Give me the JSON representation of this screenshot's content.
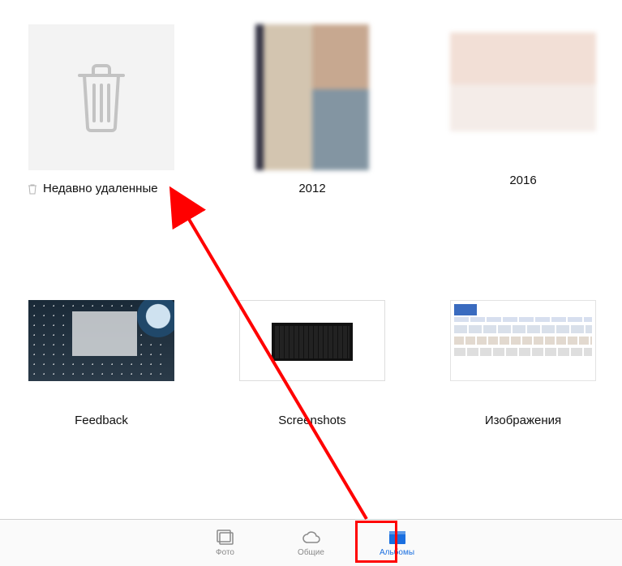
{
  "albums": [
    {
      "label": "Недавно удаленные",
      "type": "recently-deleted"
    },
    {
      "label": "2012",
      "type": "photo"
    },
    {
      "label": "2016",
      "type": "photo"
    },
    {
      "label": "Feedback",
      "type": "screenshot"
    },
    {
      "label": "Screenshots",
      "type": "screenshot"
    },
    {
      "label": "Изображения",
      "type": "screenshot"
    }
  ],
  "tabs": {
    "photos": "Фото",
    "shared": "Общие",
    "albums": "Альбомы"
  },
  "annotation": {
    "highlight_box_target": "tab-albums",
    "arrow_from": "album-recently-deleted",
    "arrow_to": "tab-albums",
    "color": "#ff0000"
  }
}
